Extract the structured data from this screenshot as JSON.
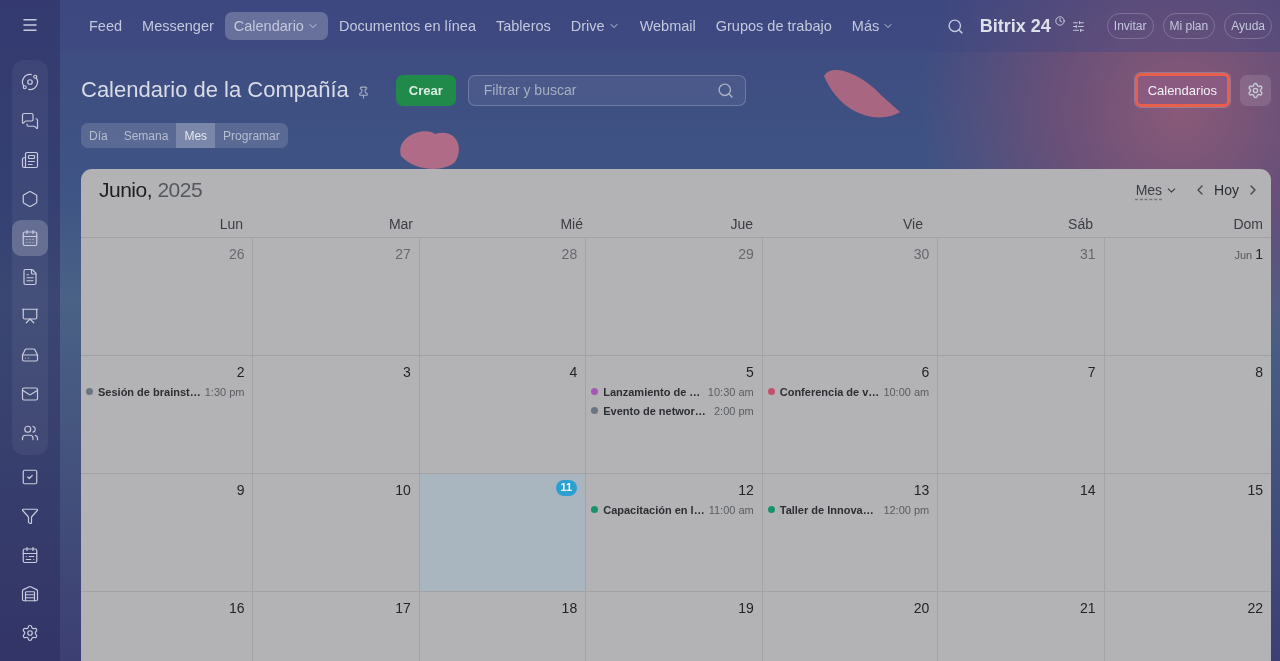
{
  "sidebar": {
    "items": [
      {
        "selected": false
      },
      {
        "selected": false
      },
      {
        "selected": false
      },
      {
        "selected": false
      },
      {
        "selected": true
      },
      {
        "selected": false
      },
      {
        "selected": false
      },
      {
        "selected": false
      },
      {
        "selected": false
      },
      {
        "selected": false
      },
      {
        "selected": false
      },
      {
        "selected": false
      },
      {
        "selected": false
      },
      {
        "selected": false
      },
      {
        "selected": false
      }
    ]
  },
  "top_nav": {
    "items": [
      {
        "label": "Feed",
        "selected": false,
        "has_menu": false
      },
      {
        "label": "Messenger",
        "selected": false,
        "has_menu": false
      },
      {
        "label": "Calendario",
        "selected": true,
        "has_menu": true
      },
      {
        "label": "Documentos en línea",
        "selected": false,
        "has_menu": false
      },
      {
        "label": "Tableros",
        "selected": false,
        "has_menu": false
      },
      {
        "label": "Drive",
        "selected": false,
        "has_menu": true
      },
      {
        "label": "Webmail",
        "selected": false,
        "has_menu": false
      },
      {
        "label": "Grupos de trabajo",
        "selected": false,
        "has_menu": false
      },
      {
        "label": "Más",
        "selected": false,
        "has_menu": true
      }
    ],
    "logo": "Bitrix 24",
    "buttons": [
      "Invitar",
      "Mi plan",
      "Ayuda"
    ]
  },
  "header": {
    "title": "Calendario de la Compañía",
    "create_button": "Crear",
    "search": {
      "placeholder": "Filtrar y buscar"
    },
    "calendars_button": "Calendarios"
  },
  "view_tabs": [
    {
      "label": "Día",
      "selected": false
    },
    {
      "label": "Semana",
      "selected": false
    },
    {
      "label": "Mes",
      "selected": true
    },
    {
      "label": "Programar",
      "selected": false
    }
  ],
  "calendar": {
    "month": "Junio,",
    "year": "2025",
    "view_select": "Mes",
    "today_button": "Hoy",
    "weekdays": [
      "Lun",
      "Mar",
      "Mié",
      "Jue",
      "Vie",
      "Sáb",
      "Dom"
    ],
    "weeks": [
      {
        "days": [
          {
            "label": "26",
            "muted": true,
            "today": false
          },
          {
            "label": "27",
            "muted": true,
            "today": false
          },
          {
            "label": "28",
            "muted": true,
            "today": false
          },
          {
            "label": "29",
            "muted": true,
            "today": false
          },
          {
            "label": "30",
            "muted": true,
            "today": false
          },
          {
            "label": "31",
            "muted": true,
            "today": false
          },
          {
            "month": "Jun",
            "label": "1",
            "muted": false,
            "today": false
          }
        ]
      },
      {
        "days": [
          {
            "label": "2",
            "muted": false,
            "today": false,
            "events": [
              {
                "title": "Sesión de brainst…",
                "time": "1:30 pm",
                "color": "#6b7482"
              }
            ]
          },
          {
            "label": "3",
            "muted": false,
            "today": false
          },
          {
            "label": "4",
            "muted": false,
            "today": false
          },
          {
            "label": "5",
            "muted": false,
            "today": false,
            "events": [
              {
                "title": "Lanzamiento de …",
                "time": "10:30 am",
                "color": "#a457b3"
              },
              {
                "title": "Evento de networ…",
                "time": "2:00 pm",
                "color": "#6b7482"
              }
            ]
          },
          {
            "label": "6",
            "muted": false,
            "today": false,
            "events": [
              {
                "title": "Conferencia de v…",
                "time": "10:00 am",
                "color": "#c64f6c"
              }
            ]
          },
          {
            "label": "7",
            "muted": false,
            "today": false
          },
          {
            "label": "8",
            "muted": false,
            "today": false
          }
        ]
      },
      {
        "days": [
          {
            "label": "9",
            "muted": false,
            "today": false
          },
          {
            "label": "10",
            "muted": false,
            "today": false
          },
          {
            "label": "11",
            "muted": false,
            "today": true
          },
          {
            "label": "12",
            "muted": false,
            "today": false,
            "events": [
              {
                "title": "Capacitación en l…",
                "time": "11:00 am",
                "color": "#16936c"
              }
            ]
          },
          {
            "label": "13",
            "muted": false,
            "today": false,
            "events": [
              {
                "title": "Taller de Innova…",
                "time": "12:00 pm",
                "color": "#16936c"
              }
            ]
          },
          {
            "label": "14",
            "muted": false,
            "today": false
          },
          {
            "label": "15",
            "muted": false,
            "today": false
          }
        ]
      },
      {
        "days": [
          {
            "label": "16",
            "muted": false,
            "today": false
          },
          {
            "label": "17",
            "muted": false,
            "today": false
          },
          {
            "label": "18",
            "muted": false,
            "today": false
          },
          {
            "label": "19",
            "muted": false,
            "today": false
          },
          {
            "label": "20",
            "muted": false,
            "today": false
          },
          {
            "label": "21",
            "muted": false,
            "today": false
          },
          {
            "label": "22",
            "muted": false,
            "today": false
          }
        ]
      }
    ]
  }
}
